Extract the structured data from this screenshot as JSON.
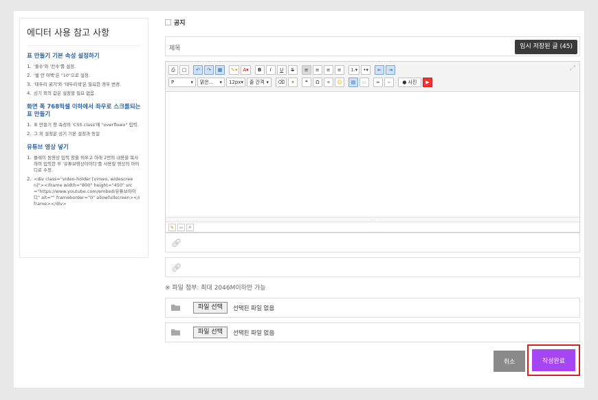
{
  "guide": {
    "title": "에디터 사용 참고 사항",
    "sections": [
      {
        "heading": "표 만들기 기본 속성 설정하기",
        "items": [
          "'줄수'와 '칸수'를 설정.",
          "'셀 안 여백'은 \"10\"으로 설정.",
          "'테두리 굵기'와 '테두리색'은 필요한 경우 변경.",
          "상기 외의 값은 설정할 필요 없음."
        ]
      },
      {
        "heading": "화면 폭 768픽셀 이하에서 좌우로 스크롤되는 표 만들기",
        "items": [
          "표 만들기 창 속성의 'CSS class'에 \"overflowx\" 입력.",
          "그 외 설정은 상기 기본 설정과 동일"
        ]
      },
      {
        "heading": "유튜브 영상 넣기",
        "items": [
          "플레이 동영상 입력 창을 띄우고 아래 2번의 내용을 복사하여 입력한 후 '유튜브영상아이디'를 사용할 영상의 아이디로 수정.",
          "<div class=\"video-holder [vimeo, widescreen]\"><iframe width=\"800\" height=\"450\" src=\"https://www.youtube.com/embed/유튜브아이디\" alt=\"\" frameborder=\"0\" allowfullscreen></iframe></div>"
        ]
      }
    ]
  },
  "form": {
    "notice_label": "공지",
    "subject_placeholder": "제목",
    "autosave_label": "임시 저장된 글 (45)",
    "toolbar": {
      "font_format": "P",
      "font_name": "맑은...",
      "font_size": "12px",
      "line_height": "줄 간격",
      "photo_label": "사진"
    },
    "file_note": "※ 파일 첨부: 최대 2046M이하만 가능",
    "files": [
      {
        "button": "파일 선택",
        "status": "선택된 파일 없음"
      },
      {
        "button": "파일 선택",
        "status": "선택된 파일 없음"
      }
    ],
    "cancel_label": "취소",
    "submit_label": "작성완료"
  },
  "colors": {
    "accent": "#a646f2",
    "guide_heading": "#2a64a6",
    "highlight_border": "#d71d1d"
  }
}
